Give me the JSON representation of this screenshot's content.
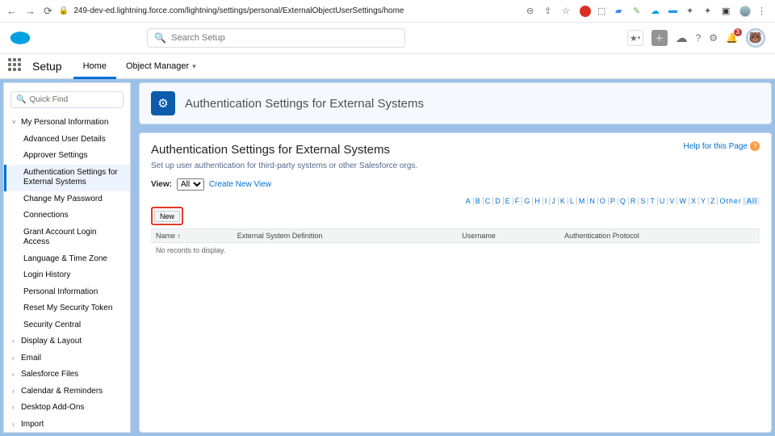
{
  "browser": {
    "url": "249-dev-ed.lightning.force.com/lightning/settings/personal/ExternalObjectUserSettings/home"
  },
  "header": {
    "search_placeholder": "Search Setup",
    "notification_count": "3"
  },
  "setup_bar": {
    "app_label": "Setup",
    "tab_home": "Home",
    "tab_obj_mgr": "Object Manager"
  },
  "sidebar": {
    "quick_find": "Quick Find",
    "items": [
      {
        "label": "My Personal Information",
        "type": "parent",
        "open": true
      },
      {
        "label": "Advanced User Details",
        "type": "child"
      },
      {
        "label": "Approver Settings",
        "type": "child"
      },
      {
        "label": "Authentication Settings for External Systems",
        "type": "child",
        "selected": true
      },
      {
        "label": "Change My Password",
        "type": "child"
      },
      {
        "label": "Connections",
        "type": "child"
      },
      {
        "label": "Grant Account Login Access",
        "type": "child"
      },
      {
        "label": "Language & Time Zone",
        "type": "child"
      },
      {
        "label": "Login History",
        "type": "child"
      },
      {
        "label": "Personal Information",
        "type": "child"
      },
      {
        "label": "Reset My Security Token",
        "type": "child"
      },
      {
        "label": "Security Central",
        "type": "child"
      },
      {
        "label": "Display & Layout",
        "type": "parent"
      },
      {
        "label": "Email",
        "type": "parent"
      },
      {
        "label": "Salesforce Files",
        "type": "parent"
      },
      {
        "label": "Calendar & Reminders",
        "type": "parent"
      },
      {
        "label": "Desktop Add-Ons",
        "type": "parent"
      },
      {
        "label": "Import",
        "type": "parent"
      }
    ]
  },
  "page": {
    "header_title": "Authentication Settings for External Systems",
    "panel_title": "Authentication Settings for External Systems",
    "panel_desc": "Set up user authentication for third-party systems or other Salesforce orgs.",
    "help_label": "Help for this Page",
    "view_label": "View:",
    "view_option": "All",
    "create_view": "Create New View",
    "new_button": "New",
    "alpha": [
      "A",
      "B",
      "C",
      "D",
      "E",
      "F",
      "G",
      "H",
      "I",
      "J",
      "K",
      "L",
      "M",
      "N",
      "O",
      "P",
      "Q",
      "R",
      "S",
      "T",
      "U",
      "V",
      "W",
      "X",
      "Y",
      "Z",
      "Other",
      "All"
    ],
    "columns": {
      "name": "Name",
      "extdef": "External System Definition",
      "username": "Username",
      "authproto": "Authentication Protocol"
    },
    "empty_row": "No records to display."
  }
}
